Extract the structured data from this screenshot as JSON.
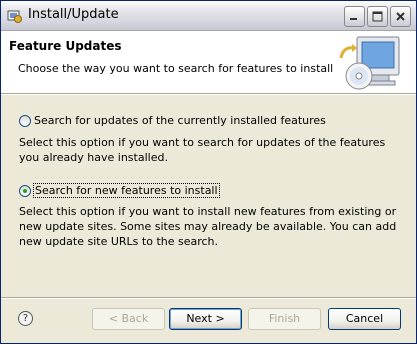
{
  "window": {
    "title": "Install/Update"
  },
  "header": {
    "title": "Feature Updates",
    "description": "Choose the way you want to search for features to install"
  },
  "options": [
    {
      "label": "Search for updates of the currently installed features",
      "description": "Select this option if you want to search for updates of the features you already have installed.",
      "checked": false
    },
    {
      "label": "Search for new features to install",
      "description": "Select this option if you want to install new features from existing or new update sites. Some sites may already be available. You can add new update site URLs to the search.",
      "checked": true
    }
  ],
  "buttons": {
    "back": "< Back",
    "next": "Next >",
    "finish": "Finish",
    "cancel": "Cancel",
    "help": "?"
  },
  "icons": {
    "app": "eclipse-install-icon",
    "header_image": "computer-cd-update-icon"
  }
}
